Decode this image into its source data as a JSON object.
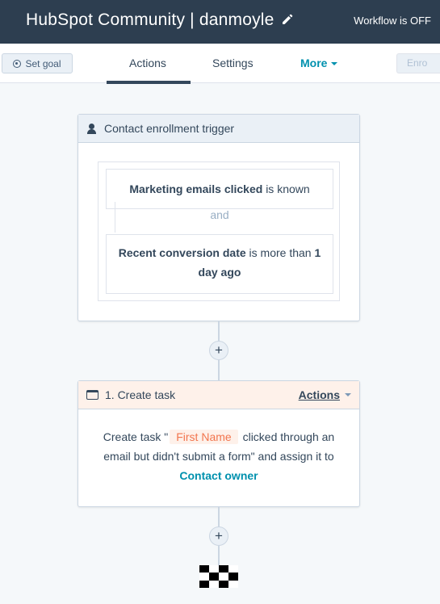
{
  "header": {
    "title": "HubSpot Community | danmoyle",
    "edit_icon": "pencil-icon",
    "workflow_status": "Workflow is OFF"
  },
  "toolbar": {
    "set_goal_label": "Set goal",
    "tabs": [
      {
        "label": "Actions",
        "active": true
      },
      {
        "label": "Settings",
        "active": false
      },
      {
        "label": "More",
        "active": false
      }
    ],
    "enroll_label": "Enro"
  },
  "trigger": {
    "header": "Contact enrollment trigger",
    "filters": [
      {
        "property": "Marketing emails clicked",
        "operator": "is known"
      },
      {
        "property": "Recent conversion date",
        "operator": "is more than",
        "value": "1 day ago"
      }
    ],
    "joiner": "and"
  },
  "task": {
    "header": "1. Create task",
    "actions_label": "Actions",
    "text_prefix": "Create task \"",
    "token": "First Name",
    "text_middle": " clicked through an email but didn't submit a form\" and assign it to",
    "owner": "Contact owner"
  },
  "colors": {
    "topbar": "#2d3e50",
    "accent": "#0091ae",
    "token": "#f2754e"
  }
}
